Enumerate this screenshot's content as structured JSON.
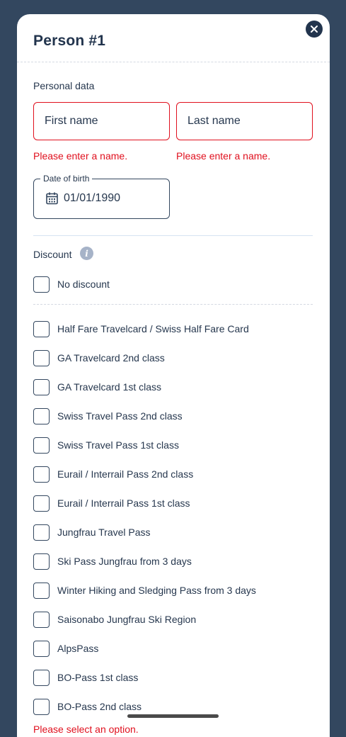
{
  "modal": {
    "title": "Person #1"
  },
  "personal": {
    "section_label": "Personal data",
    "first_name_placeholder": "First name",
    "last_name_placeholder": "Last name",
    "first_name_error": "Please enter a name.",
    "last_name_error": "Please enter a name.",
    "dob_label": "Date of birth",
    "dob_value": "01/01/1990"
  },
  "discount": {
    "section_label": "Discount",
    "info_glyph": "i",
    "no_discount": "No discount",
    "options": [
      "Half Fare Travelcard / Swiss Half Fare Card",
      "GA Travelcard 2nd class",
      "GA Travelcard 1st class",
      "Swiss Travel Pass 2nd class",
      "Swiss Travel Pass 1st class",
      "Eurail / Interrail Pass 2nd class",
      "Eurail / Interrail Pass 1st class",
      "Jungfrau Travel Pass",
      "Ski Pass Jungfrau from 3 days",
      "Winter Hiking and Sledging Pass from 3 days",
      "Saisonabo Jungfrau Ski Region",
      "AlpsPass",
      "BO-Pass 1st class",
      "BO-Pass 2nd class"
    ],
    "bottom_error": "Please select an option."
  },
  "colors": {
    "backdrop": "#33475f",
    "text": "#26374e",
    "error": "#e0101e",
    "info_icon": "#a6b3c8"
  }
}
